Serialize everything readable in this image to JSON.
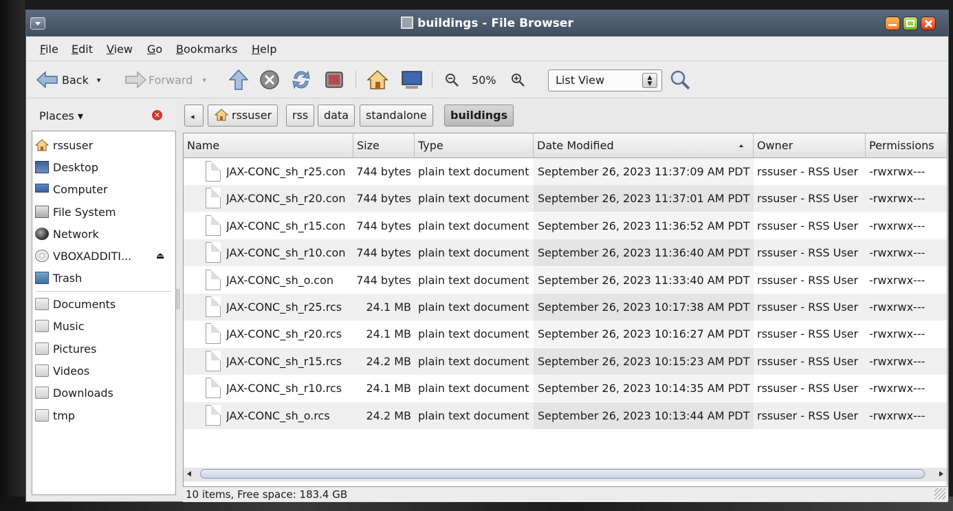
{
  "window": {
    "title": "buildings - File Browser"
  },
  "menubar": {
    "items": [
      {
        "mnemonic": "F",
        "rest": "ile"
      },
      {
        "mnemonic": "E",
        "rest": "dit"
      },
      {
        "mnemonic": "V",
        "rest": "iew"
      },
      {
        "mnemonic": "G",
        "rest": "o"
      },
      {
        "mnemonic": "B",
        "rest": "ookmarks"
      },
      {
        "mnemonic": "H",
        "rest": "elp"
      }
    ]
  },
  "toolbar": {
    "back_label": "Back",
    "forward_label": "Forward",
    "zoom_level": "50%",
    "view_mode": "List View"
  },
  "sidebar": {
    "header": "Places",
    "items": [
      {
        "label": "rssuser",
        "icon": "home-icon"
      },
      {
        "label": "Desktop",
        "icon": "desktop-icon"
      },
      {
        "label": "Computer",
        "icon": "computer-icon"
      },
      {
        "label": "File System",
        "icon": "filesystem-icon"
      },
      {
        "label": "Network",
        "icon": "network-icon"
      },
      {
        "label": "VBOXADDITI...",
        "icon": "cdrom-icon"
      },
      {
        "label": "Trash",
        "icon": "trash-icon"
      }
    ],
    "bookmarks": [
      {
        "label": "Documents"
      },
      {
        "label": "Music"
      },
      {
        "label": "Pictures"
      },
      {
        "label": "Videos"
      },
      {
        "label": "Downloads"
      },
      {
        "label": "tmp"
      }
    ]
  },
  "pathbar": {
    "crumbs": [
      "rssuser",
      "rss",
      "data",
      "standalone",
      "buildings"
    ]
  },
  "filelist": {
    "columns": [
      "Name",
      "Size",
      "Type",
      "Date Modified",
      "Owner",
      "Permissions"
    ],
    "rows": [
      {
        "name": "JAX-CONC_sh_r25.con",
        "size": "744 bytes",
        "type": "plain text document",
        "date": "September 26, 2023 11:37:09 AM PDT",
        "owner": "rssuser - RSS User",
        "perms": "-rwxrwx---"
      },
      {
        "name": "JAX-CONC_sh_r20.con",
        "size": "744 bytes",
        "type": "plain text document",
        "date": "September 26, 2023 11:37:01 AM PDT",
        "owner": "rssuser - RSS User",
        "perms": "-rwxrwx---"
      },
      {
        "name": "JAX-CONC_sh_r15.con",
        "size": "744 bytes",
        "type": "plain text document",
        "date": "September 26, 2023 11:36:52 AM PDT",
        "owner": "rssuser - RSS User",
        "perms": "-rwxrwx---"
      },
      {
        "name": "JAX-CONC_sh_r10.con",
        "size": "744 bytes",
        "type": "plain text document",
        "date": "September 26, 2023 11:36:40 AM PDT",
        "owner": "rssuser - RSS User",
        "perms": "-rwxrwx---"
      },
      {
        "name": "JAX-CONC_sh_o.con",
        "size": "744 bytes",
        "type": "plain text document",
        "date": "September 26, 2023 11:33:40 AM PDT",
        "owner": "rssuser - RSS User",
        "perms": "-rwxrwx---"
      },
      {
        "name": "JAX-CONC_sh_r25.rcs",
        "size": "24.1 MB",
        "type": "plain text document",
        "date": "September 26, 2023 10:17:38 AM PDT",
        "owner": "rssuser - RSS User",
        "perms": "-rwxrwx---"
      },
      {
        "name": "JAX-CONC_sh_r20.rcs",
        "size": "24.1 MB",
        "type": "plain text document",
        "date": "September 26, 2023 10:16:27 AM PDT",
        "owner": "rssuser - RSS User",
        "perms": "-rwxrwx---"
      },
      {
        "name": "JAX-CONC_sh_r15.rcs",
        "size": "24.2 MB",
        "type": "plain text document",
        "date": "September 26, 2023 10:15:23 AM PDT",
        "owner": "rssuser - RSS User",
        "perms": "-rwxrwx---"
      },
      {
        "name": "JAX-CONC_sh_r10.rcs",
        "size": "24.1 MB",
        "type": "plain text document",
        "date": "September 26, 2023 10:14:35 AM PDT",
        "owner": "rssuser - RSS User",
        "perms": "-rwxrwx---"
      },
      {
        "name": "JAX-CONC_sh_o.rcs",
        "size": "24.2 MB",
        "type": "plain text document",
        "date": "September 26, 2023 10:13:44 AM PDT",
        "owner": "rssuser - RSS User",
        "perms": "-rwxrwx---"
      }
    ]
  },
  "status": {
    "text": "10 items, Free space: 183.4 GB"
  }
}
